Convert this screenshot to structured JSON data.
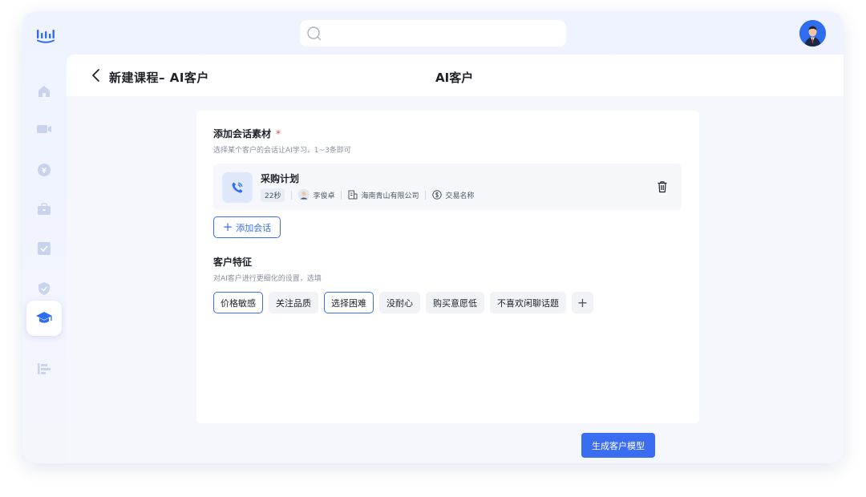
{
  "header": {
    "breadcrumb": "新建课程– AI客户",
    "title": "AI客户"
  },
  "sidebar": {
    "items": [
      "home-icon",
      "video-icon",
      "coin-icon",
      "briefcase-icon",
      "checkbox-icon",
      "shield-icon",
      "graduation-cap-icon",
      "bar-list-icon"
    ],
    "active": "graduation-cap-icon"
  },
  "material": {
    "title": "添加会话素材",
    "required_mark": "*",
    "subtitle": "选择某个客户的会话让AI学习，1~3条即可",
    "conversation": {
      "title": "采购计划",
      "duration": "22秒",
      "person": "李俊卓",
      "company": "海南青山有限公司",
      "deal": "交易名称"
    },
    "add_button": "添加会话",
    "add_plus": "+"
  },
  "features": {
    "title": "客户特征",
    "subtitle": "对AI客户进行更细化的设置，选填",
    "tags": [
      {
        "label": "价格敏感",
        "selected": true
      },
      {
        "label": "关注品质",
        "selected": false
      },
      {
        "label": "选择困难",
        "selected": true
      },
      {
        "label": "没耐心",
        "selected": false
      },
      {
        "label": "购买意愿低",
        "selected": false
      },
      {
        "label": "不喜欢闲聊话题",
        "selected": false
      }
    ],
    "add_tag": "+"
  },
  "footer": {
    "generate_button": "生成客户模型"
  },
  "colors": {
    "accent": "#3a6df0",
    "required": "#e5484d",
    "sidebar_icon": "#c9d3ee"
  }
}
